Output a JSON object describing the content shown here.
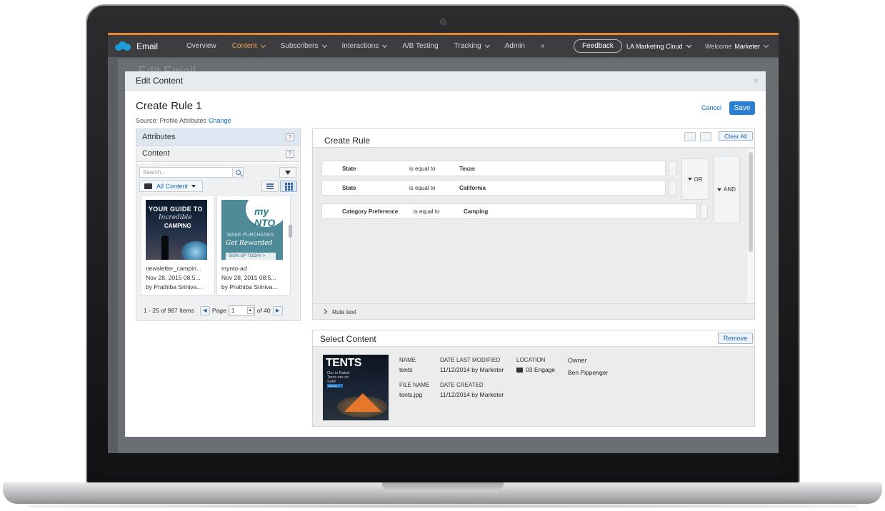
{
  "nav": {
    "brand": "Email",
    "items": [
      "Overview",
      "Content",
      "Subscribers",
      "Interactions",
      "A/B Testing",
      "Tracking",
      "Admin"
    ],
    "more": "»",
    "feedback": "Feedback",
    "org": "LA Marketing Cloud",
    "welcome_prefix": "Welcome",
    "welcome_user": "Marketer",
    "accent_color": "#e68a2e"
  },
  "background": {
    "page_title": "Edit Email"
  },
  "modal": {
    "title": "Edit Content",
    "close": "×",
    "rule_title": "Create Rule 1",
    "source_label": "Source: Profile Attributes",
    "source_change": "Change",
    "cancel": "Cancel",
    "save": "Save"
  },
  "left_panel": {
    "attributes": "Attributes",
    "content": "Content",
    "help": "?",
    "search_placeholder": "Search...",
    "folder": "All Content",
    "cards": [
      {
        "name": "newsletter_campin...",
        "date": "Nov 28, 2015 08:5...",
        "by": "by Prathiba Sriniva...",
        "image_text": [
          "YOUR GUIDE TO",
          "Incredible",
          "CAMPING"
        ]
      },
      {
        "name": "mynto-ad",
        "date": "Nov 28, 2015 08:5...",
        "by": "by Prathiba Sriniva...",
        "image_text": [
          "my NTO",
          "MAKE PURCHASES",
          "Get Rewarded",
          "SIGN UP TODAY >"
        ]
      }
    ],
    "pager": {
      "range": "1 - 25 of 987 Items",
      "page_label": "Page",
      "page": "1",
      "of": "of 40"
    }
  },
  "rule_panel": {
    "title": "Create Rule",
    "clear_all": "Clear All",
    "conditions": [
      {
        "field": "State",
        "operator": "is equal to",
        "value": "Texas"
      },
      {
        "field": "State",
        "operator": "is equal to",
        "value": "California"
      },
      {
        "field": "Category Preference",
        "operator": "is equal to",
        "value": "Camping"
      }
    ],
    "or_label": "OR",
    "and_label": "AND",
    "rule_text": "Rule text"
  },
  "select_panel": {
    "title": "Select Content",
    "remove": "Remove",
    "thumb_text": [
      "TENTS",
      "Our in Rated Tents are on Sale!",
      "VIEW ALL >"
    ],
    "name_h": "NAME",
    "name_v": "tents",
    "modified_h": "DATE LAST MODIFIED",
    "modified_v": "11/12/2014 by Marketer",
    "location_h": "LOCATION",
    "location_v": "03 Engage",
    "owner_h": "Owner",
    "owner_v": "Ben Pippenger",
    "file_h": "FILE NAME",
    "file_v": "tents.jpg",
    "created_h": "DATE CREATED",
    "created_v": "11/12/2014 by Marketer"
  }
}
